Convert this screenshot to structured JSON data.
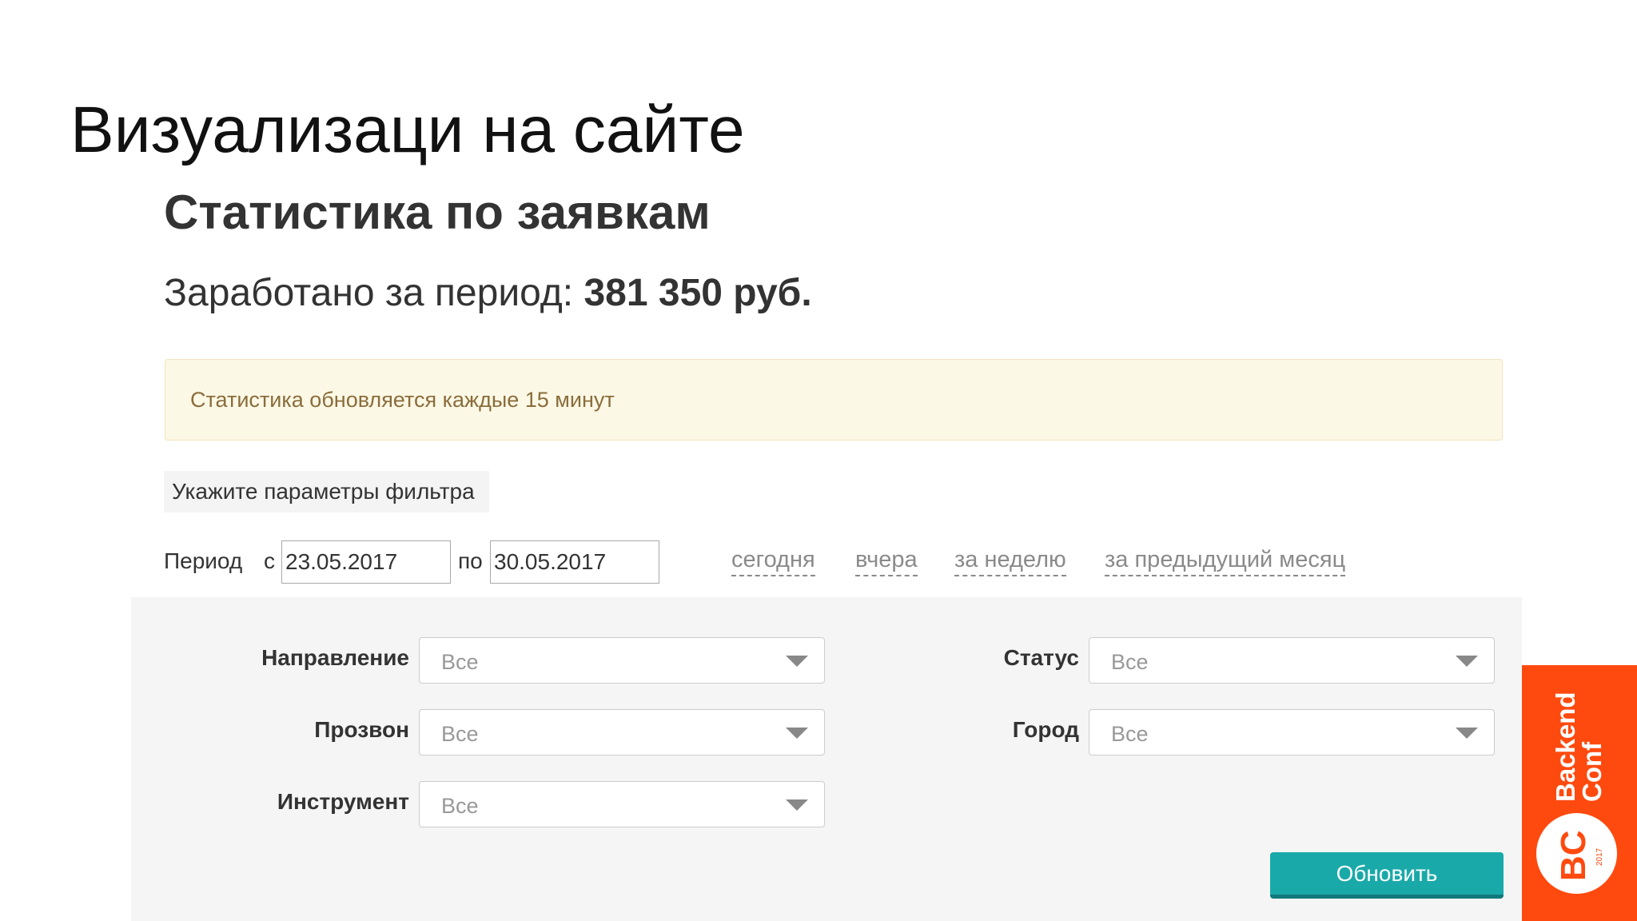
{
  "slide": {
    "title": "Визуализаци на сайте"
  },
  "stats": {
    "heading": "Статистика по заявкам",
    "earned_label": "Заработано за период: ",
    "earned_value": "381 350 руб."
  },
  "alert": {
    "text": "Статистика обновляется каждые 15 минут"
  },
  "filter": {
    "tab_label": "Укажите параметры фильтра",
    "period": {
      "label": "Период",
      "from_label": "с",
      "from_value": "23.05.2017",
      "to_label": "по",
      "to_value": "30.05.2017"
    },
    "quick_links": [
      "сегодня",
      "вчера",
      "за неделю",
      "за предыдущий месяц"
    ],
    "fields": {
      "direction": {
        "label": "Направление",
        "value": "Все"
      },
      "call": {
        "label": "Прозвон",
        "value": "Все"
      },
      "tool": {
        "label": "Инструмент",
        "value": "Все"
      },
      "status": {
        "label": "Статус",
        "value": "Все"
      },
      "city": {
        "label": "Город",
        "value": "Все"
      }
    },
    "submit_label": "Обновить"
  },
  "brand": {
    "name_line1": "Backend",
    "name_line2": "Conf",
    "mark": "BC",
    "year": "2017",
    "color": "#ff4a0f"
  },
  "colors": {
    "button": "#1aa9a9",
    "alert_bg": "#fcf8e6"
  }
}
